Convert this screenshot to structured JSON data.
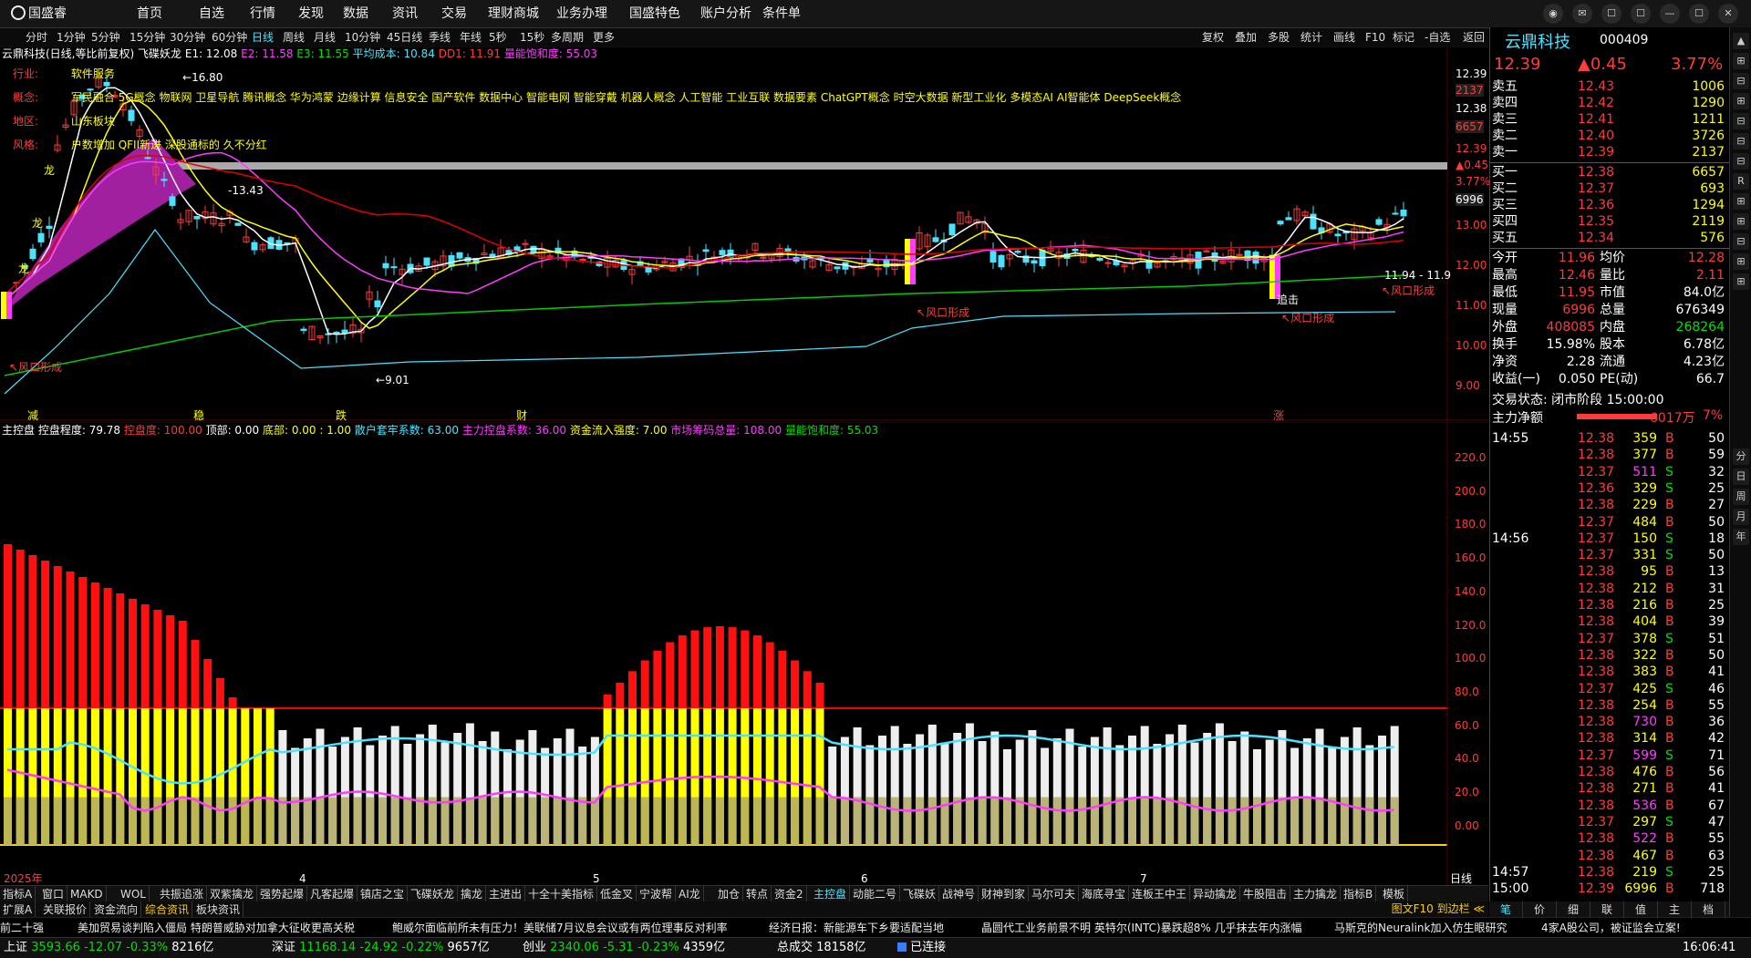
{
  "menu": {
    "logo": "国盛睿",
    "items": [
      "首页",
      "自选",
      "行情",
      "发现",
      "数据",
      "资讯",
      "交易",
      "理财商城",
      "业务办理",
      "国盛特色",
      "账户分析",
      "条件单"
    ]
  },
  "window_buttons": [
    "◉",
    "✉",
    "☐",
    "☐",
    "—",
    "☐",
    "✕"
  ],
  "periods": [
    "分时",
    "1分钟",
    "5分钟",
    "15分钟",
    "30分钟",
    "60分钟",
    "日线",
    "周线",
    "月线",
    "10分钟",
    "45日线",
    "季线",
    "年线",
    "5秒",
    "15秒",
    "多周期",
    "更多"
  ],
  "active_period": "日线",
  "toolbar_right": [
    "复权",
    "叠加",
    "多股",
    "统计",
    "画线",
    "F10",
    "标记",
    "-自选",
    "返回"
  ],
  "main_legend": {
    "title": "云鼎科技(日线,等比前复权)",
    "indicator": "飞碟妖龙",
    "e1": "E1: 12.08",
    "e2": "E2: 11.58",
    "e3": "E3: 11.55",
    "avg": "平均成本: 10.84",
    "dd1": "DD1: 11.91",
    "sat": "量能饱和度: 55.03"
  },
  "info_rows": [
    {
      "label": "行业:",
      "value": "软件服务"
    },
    {
      "label": "概念:",
      "value": "军民融合 5G概念 物联网 卫星导航 腾讯概念 华为鸿蒙 边缘计算 信息安全 国产软件 数据中心 智能电网 智能穿戴 机器人概念 人工智能 工业互联 数据要素 ChatGPT概念 时空大数据 新型工业化 多模态AI AI智能体 DeepSeek概念"
    },
    {
      "label": "地区:",
      "value": "山东板块"
    },
    {
      "label": "风格:",
      "value": "户数增加 QFII新进 深股通标的 久不分红"
    }
  ],
  "main_annotations": {
    "high": "16.80",
    "low": "9.01",
    "mid": "13.43",
    "range": "11.94 - 11.9",
    "signal": "风口形成",
    "dragon": "龙",
    "chase": "追击",
    "markers": [
      "减",
      "稳",
      "跌",
      "财",
      "涨"
    ]
  },
  "main_axis": {
    "labels": [
      "12.39",
      "2137",
      "12.38",
      "6657",
      "12.39",
      "▲0.45",
      "3.77%",
      "6996",
      "13.00",
      "12.00",
      "11.00",
      "10.00",
      "9.00"
    ],
    "ticks": [
      "13.00",
      "12.00",
      "11.00",
      "10.00",
      "9.00"
    ]
  },
  "ind_legend": {
    "name": "主控盘",
    "control": "控盘程度: 79.78",
    "full": "控盘度: 100.00",
    "top": "顶部: 0.00",
    "bottom": "底部: 0.00 : 1.00",
    "retail": "散户套牢系数: 63.00",
    "main": "主力控盘系数: 36.00",
    "inflow": "资金流入强度: 7.00",
    "chips": "市场筹码总量: 108.00",
    "sat": "量能饱和度: 55.03"
  },
  "ind_axis": [
    "220.0",
    "200.0",
    "180.0",
    "160.0",
    "140.0",
    "120.0",
    "100.0",
    "80.0",
    "60.0",
    "40.0",
    "20.0",
    "0.00"
  ],
  "x_axis": {
    "year": "2025年",
    "months": [
      "4",
      "5",
      "6",
      "7"
    ],
    "label": "日线"
  },
  "bottom_tabs": [
    "指标A",
    "窗口",
    "MAKD",
    "WOL",
    "共振追涨",
    "双紫擒龙",
    "强势起爆",
    "凡客起爆",
    "镇店之宝",
    "飞碟妖龙",
    "擒龙",
    "主进出",
    "十全十美指标",
    "低金叉",
    "宁波帮",
    "AI龙",
    "加仓",
    "转点",
    "资金2",
    "主控盘",
    "动能二号",
    "飞碟妖",
    "战神号",
    "财神到家",
    "马尔可夫",
    "海底寻宝",
    "连板王中王",
    "异动擒龙",
    "牛股阻击",
    "主力擒龙",
    "指标B",
    "模板"
  ],
  "active_tab": "主控盘",
  "bottom_tabs2": [
    "扩展A",
    "关联报价",
    "资金流向",
    "综合资讯",
    "板块资讯"
  ],
  "bottom_tabs2_right": "图文F10 到边栏 ≪",
  "news": [
    "前二十强",
    "美加贸易谈判陷入僵局 特朗普威胁对加拿大征收更高关税",
    "鲍威尔面临前所未有压力！美联储7月议息会议或有两位理事反对利率",
    "经济日报：新能源车下乡要适配当地",
    "晶圆代工业务前景不明 英特尔(INTC)暴跌超8% 几乎抹去年内涨幅",
    "马斯克的Neuralink加入仿生眼研究",
    "4家A股公司，被证监会立案!"
  ],
  "status": {
    "sh_name": "上证",
    "sh_val": "3593.66",
    "sh_chg": "-12.07",
    "sh_pct": "-0.33%",
    "sh_amt": "8216亿",
    "sz_name": "深证",
    "sz_val": "11168.14",
    "sz_chg": "-24.92",
    "sz_pct": "-0.22%",
    "sz_amt": "9657亿",
    "cy_name": "创业",
    "cy_val": "2340.06",
    "cy_chg": "-5.31",
    "cy_pct": "-0.23%",
    "cy_amt": "4359亿",
    "total_label": "总成交",
    "total_val": "18158亿",
    "conn": "已连接",
    "time": "16:06:41"
  },
  "quote": {
    "name": "云鼎科技",
    "code": "000409",
    "price": "12.39",
    "change": "▲0.45",
    "pct": "3.77%",
    "asks": [
      [
        "卖五",
        "12.43",
        "1006"
      ],
      [
        "卖四",
        "12.42",
        "1290"
      ],
      [
        "卖三",
        "12.41",
        "1211"
      ],
      [
        "卖二",
        "12.40",
        "3726"
      ],
      [
        "卖一",
        "12.39",
        "2137"
      ]
    ],
    "bids": [
      [
        "买一",
        "12.38",
        "6657"
      ],
      [
        "买二",
        "12.37",
        "693"
      ],
      [
        "买三",
        "12.36",
        "1294"
      ],
      [
        "买四",
        "12.35",
        "2119"
      ],
      [
        "买五",
        "12.34",
        "576"
      ]
    ],
    "stats": [
      [
        "今开",
        "11.96",
        "均价",
        "12.28"
      ],
      [
        "最高",
        "12.46",
        "量比",
        "2.11"
      ],
      [
        "最低",
        "11.95",
        "市值",
        "84.0亿"
      ],
      [
        "现量",
        "6996",
        "总量",
        "676349"
      ],
      [
        "外盘",
        "408085",
        "内盘",
        "268264"
      ],
      [
        "换手",
        "15.98%",
        "股本",
        "6.78亿"
      ],
      [
        "净资",
        "2.28",
        "流通",
        "4.23亿"
      ],
      [
        "收益(一)",
        "0.050",
        "PE(动)",
        "66.7"
      ]
    ],
    "trade_state": "交易状态: 闭市阶段 15:00:00",
    "net_label": "主力净额",
    "net_val": "6017万",
    "net_pct": "7%"
  },
  "ticks": [
    {
      "t": "14:55",
      "p": "12.38",
      "v": "359",
      "d": "B",
      "n": "50"
    },
    {
      "t": "",
      "p": "12.38",
      "v": "377",
      "d": "B",
      "n": "59"
    },
    {
      "t": "",
      "p": "12.37",
      "v": "511",
      "d": "S",
      "n": "32"
    },
    {
      "t": "",
      "p": "12.36",
      "v": "329",
      "d": "S",
      "n": "25"
    },
    {
      "t": "",
      "p": "12.38",
      "v": "229",
      "d": "B",
      "n": "27"
    },
    {
      "t": "",
      "p": "12.37",
      "v": "484",
      "d": "B",
      "n": "50"
    },
    {
      "t": "14:56",
      "p": "12.37",
      "v": "150",
      "d": "S",
      "n": "18"
    },
    {
      "t": "",
      "p": "12.37",
      "v": "331",
      "d": "S",
      "n": "50"
    },
    {
      "t": "",
      "p": "12.38",
      "v": "95",
      "d": "B",
      "n": "13"
    },
    {
      "t": "",
      "p": "12.38",
      "v": "212",
      "d": "B",
      "n": "31"
    },
    {
      "t": "",
      "p": "12.38",
      "v": "216",
      "d": "B",
      "n": "25"
    },
    {
      "t": "",
      "p": "12.38",
      "v": "404",
      "d": "B",
      "n": "39"
    },
    {
      "t": "",
      "p": "12.37",
      "v": "378",
      "d": "S",
      "n": "51"
    },
    {
      "t": "",
      "p": "12.38",
      "v": "322",
      "d": "B",
      "n": "50"
    },
    {
      "t": "",
      "p": "12.38",
      "v": "383",
      "d": "B",
      "n": "41"
    },
    {
      "t": "",
      "p": "12.37",
      "v": "425",
      "d": "S",
      "n": "46"
    },
    {
      "t": "",
      "p": "12.38",
      "v": "254",
      "d": "B",
      "n": "55"
    },
    {
      "t": "",
      "p": "12.38",
      "v": "730",
      "d": "B",
      "n": "36"
    },
    {
      "t": "",
      "p": "12.38",
      "v": "314",
      "d": "B",
      "n": "42"
    },
    {
      "t": "",
      "p": "12.37",
      "v": "599",
      "d": "S",
      "n": "71"
    },
    {
      "t": "",
      "p": "12.38",
      "v": "476",
      "d": "B",
      "n": "56"
    },
    {
      "t": "",
      "p": "12.38",
      "v": "271",
      "d": "B",
      "n": "41"
    },
    {
      "t": "",
      "p": "12.38",
      "v": "536",
      "d": "B",
      "n": "67"
    },
    {
      "t": "",
      "p": "12.37",
      "v": "297",
      "d": "S",
      "n": "47"
    },
    {
      "t": "",
      "p": "12.38",
      "v": "522",
      "d": "B",
      "n": "55"
    },
    {
      "t": "",
      "p": "12.38",
      "v": "467",
      "d": "B",
      "n": "63"
    },
    {
      "t": "14:57",
      "p": "12.38",
      "v": "219",
      "d": "S",
      "n": "25"
    },
    {
      "t": "15:00",
      "p": "12.39",
      "v": "6996",
      "d": "B",
      "n": "718"
    }
  ],
  "rp_tabs": [
    "笔",
    "价",
    "细",
    "联",
    "值",
    "主",
    "档"
  ],
  "side_buttons": [
    "▲",
    "⊞",
    "⊟",
    "⊞",
    "⊟",
    "⊟",
    "⊟",
    "R",
    "⊞",
    "⊞",
    "⊟",
    "⊞",
    "⊞",
    "分",
    "日",
    "周",
    "月",
    "年"
  ],
  "colors": {
    "up": "#ff3b3b",
    "down": "#00e000",
    "cyan": "#49e3ff",
    "yellow": "#ffff00",
    "magenta": "#ff3bff"
  }
}
